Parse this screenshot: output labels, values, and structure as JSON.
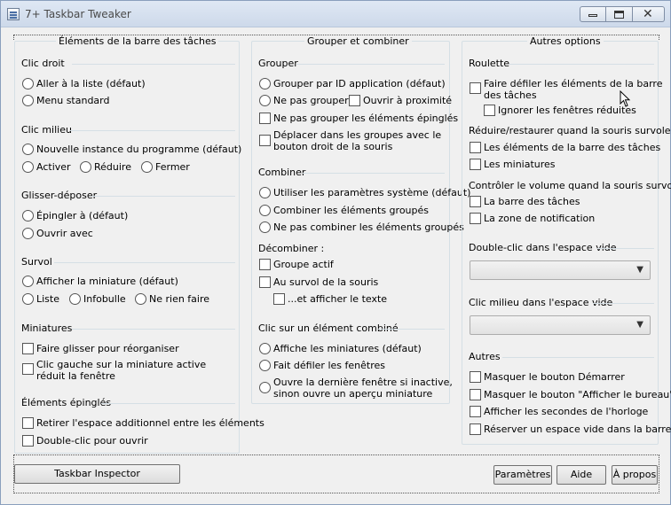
{
  "window": {
    "title": "7+ Taskbar Tweaker"
  },
  "col1": {
    "title": "Éléments de la barre des tâches",
    "clic_droit": {
      "title": "Clic droit",
      "opts": [
        "Aller à la liste (défaut)",
        "Menu standard"
      ]
    },
    "clic_milieu": {
      "title": "Clic milieu",
      "opts": [
        "Nouvelle instance du programme (défaut)",
        "Activer",
        "Réduire",
        "Fermer"
      ]
    },
    "glisser": {
      "title": "Glisser-déposer",
      "opts": [
        "Épingler à (défaut)",
        "Ouvrir avec"
      ]
    },
    "survol": {
      "title": "Survol",
      "opts": [
        "Afficher la miniature (défaut)",
        "Liste",
        "Infobulle",
        "Ne rien faire"
      ]
    },
    "miniatures": {
      "title": "Miniatures",
      "opt1": "Faire glisser pour réorganiser",
      "opt2a": "Clic gauche sur la miniature active",
      "opt2b": "réduit la fenêtre"
    },
    "epingles": {
      "title": "Éléments épinglés",
      "opts": [
        "Retirer l'espace additionnel entre les éléments",
        "Double-clic pour ouvrir"
      ]
    }
  },
  "col2": {
    "title": "Grouper et combiner",
    "grouper": {
      "title": "Grouper",
      "opt1": "Grouper par ID application (défaut)",
      "opt2": "Ne pas grouper",
      "opt2b": "Ouvrir à proximité",
      "opt3": "Ne pas grouper les éléments épinglés",
      "opt4a": "Déplacer dans les groupes avec le",
      "opt4b": "bouton droit de la souris"
    },
    "combiner": {
      "title": "Combiner",
      "opts": [
        "Utiliser les paramètres système (défaut)",
        "Combiner les éléments groupés",
        "Ne pas combiner les éléments groupés"
      ]
    },
    "decombiner": {
      "title": "Décombiner :",
      "opts": [
        "Groupe actif",
        "Au survol de la souris",
        "...et afficher le texte"
      ]
    },
    "clic_combine": {
      "title": "Clic sur un élément combiné",
      "opt1": "Affiche les miniatures (défaut)",
      "opt2": "Fait défiler les fenêtres",
      "opt3a": "Ouvre la dernière fenêtre si inactive,",
      "opt3b": "sinon ouvre un aperçu miniature"
    }
  },
  "col3": {
    "title": "Autres options",
    "roulette": {
      "title": "Roulette",
      "opt1a": "Faire défiler les éléments de la barre",
      "opt1b": "des tâches",
      "opt2": "Ignorer les fenêtres réduites",
      "restore_label": "Réduire/restaurer quand la souris survole :",
      "opt3": "Les éléments de la barre des tâches",
      "opt4": "Les miniatures",
      "volume_label": "Contrôler le volume quand la souris survole :",
      "opt5": "La barre des tâches",
      "opt6": "La zone de notification"
    },
    "dbl_clic": {
      "title": "Double-clic dans l'espace vide",
      "value": ""
    },
    "mid_clic": {
      "title": "Clic milieu dans l'espace vide",
      "value": ""
    },
    "autres": {
      "title": "Autres",
      "opts": [
        "Masquer le bouton Démarrer",
        "Masquer le bouton \"Afficher le bureau\"",
        "Afficher les secondes de l'horloge",
        "Réserver un espace vide dans la barre"
      ]
    }
  },
  "buttons": {
    "inspector": "Taskbar Inspector",
    "parametres": "Paramètres",
    "aide": "Aide",
    "apropos": "À propos"
  }
}
